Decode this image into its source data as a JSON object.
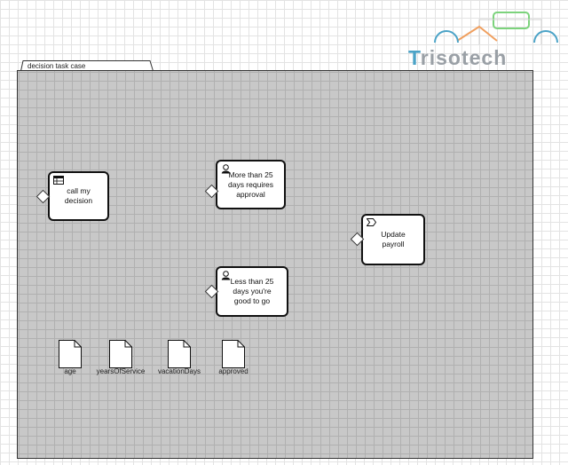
{
  "logo": {
    "first_letter": "T",
    "rest": "risotech"
  },
  "case": {
    "label": "decision task case"
  },
  "tasks": [
    {
      "id": "call-my-decision",
      "type": "decision-task",
      "icon": "table-icon",
      "label": "call my decision"
    },
    {
      "id": "more-than-25",
      "type": "user-task",
      "icon": "user-icon",
      "label": "More than 25 days requires approval"
    },
    {
      "id": "update-payroll",
      "type": "process-task",
      "icon": "chevron-icon",
      "label": "Update payroll"
    },
    {
      "id": "less-than-25",
      "type": "user-task",
      "icon": "user-icon",
      "label": "Less than 25 days you're good to go"
    }
  ],
  "case_files": [
    {
      "label": "age"
    },
    {
      "label": "yearsOfService"
    },
    {
      "label": "vacationDays"
    },
    {
      "label": "approved"
    }
  ],
  "colors": {
    "logo_blue": "#4ba3c7",
    "logo_gray": "#9aa0a6",
    "logo_orange": "#f0a060",
    "logo_green": "#7cd37c",
    "case_fill": "#c8c8c8"
  }
}
